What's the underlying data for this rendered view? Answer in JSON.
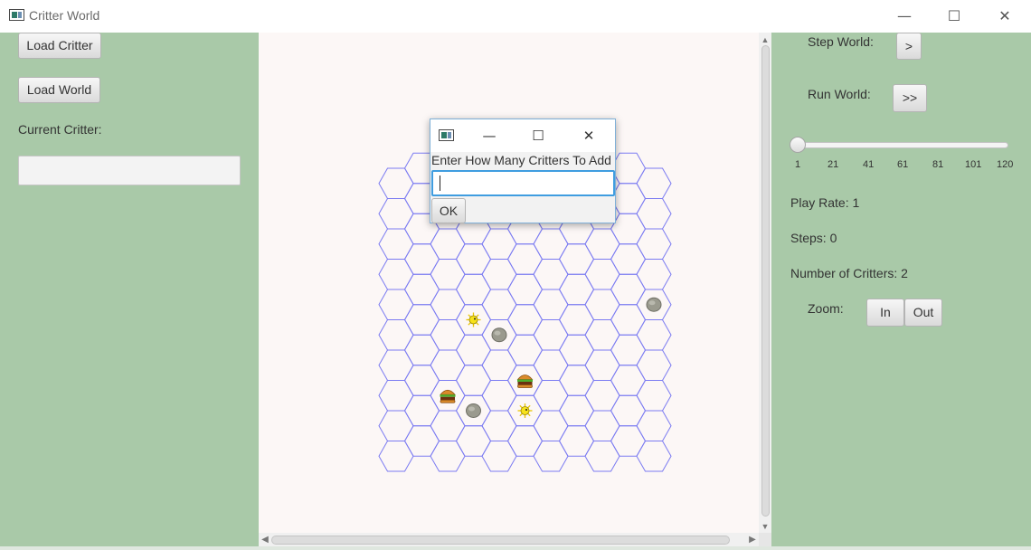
{
  "window": {
    "title": "Critter World",
    "minimize_glyph": "—",
    "maximize_glyph": "☐",
    "close_glyph": "✕"
  },
  "left_panel": {
    "load_critter_label": "Load Critter",
    "load_world_label": "Load World",
    "current_critter_label": "Current Critter:",
    "current_critter_value": ""
  },
  "right_panel": {
    "step_world_label": "Step World:",
    "step_button_label": ">",
    "run_world_label": "Run World:",
    "run_button_label": ">>",
    "slider": {
      "min": 1,
      "max": 120,
      "value": 1,
      "ticks": [
        "1",
        "21",
        "41",
        "61",
        "81",
        "101",
        "120"
      ]
    },
    "play_rate_text": "Play Rate: 1",
    "steps_text": "Steps: 0",
    "critters_text": "Number of Critters: 2",
    "zoom_label": "Zoom:",
    "zoom_in_label": "In",
    "zoom_out_label": "Out"
  },
  "world": {
    "columns": 11,
    "rows": 10,
    "grid_color": "#7b7bf2",
    "background": "#fcf7f6",
    "objects": [
      {
        "type": "rock",
        "col": 10,
        "row": 4
      },
      {
        "type": "rock",
        "col": 4,
        "row": 5
      },
      {
        "type": "critter",
        "col": 3,
        "row": 5
      },
      {
        "type": "food",
        "col": 2,
        "row": 7
      },
      {
        "type": "food",
        "col": 5,
        "row": 7
      },
      {
        "type": "rock",
        "col": 3,
        "row": 8
      },
      {
        "type": "critter",
        "col": 5,
        "row": 8
      }
    ]
  },
  "dialog": {
    "prompt": "Enter How Many Critters To Add",
    "input_value": "",
    "ok_label": "OK",
    "minimize_glyph": "—",
    "maximize_glyph": "☐",
    "close_glyph": "✕"
  },
  "colors": {
    "panel_green": "#a9c9a8",
    "focus_blue": "#3f9de0"
  }
}
